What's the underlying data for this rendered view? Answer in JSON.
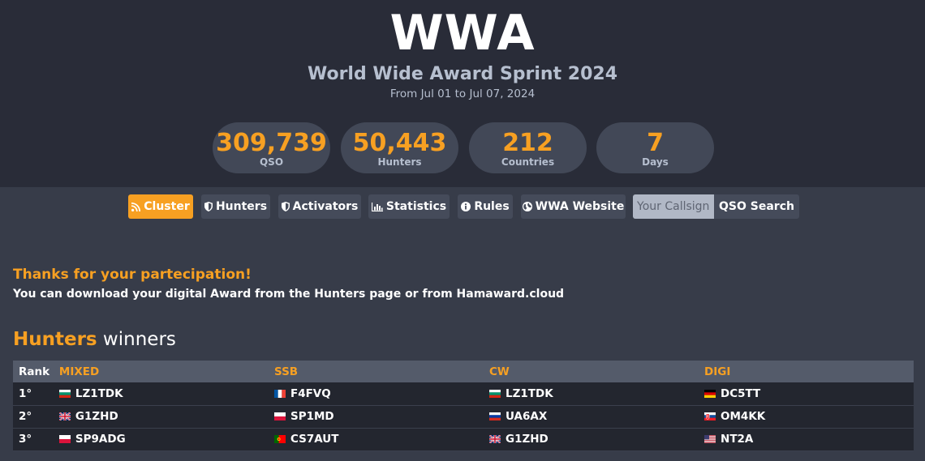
{
  "header": {
    "logo": "WWA",
    "title": "World Wide Award Sprint 2024",
    "dates": "From Jul 01 to Jul 07, 2024"
  },
  "stats": [
    {
      "value": "309,739",
      "label": "QSO"
    },
    {
      "value": "50,443",
      "label": "Hunters"
    },
    {
      "value": "212",
      "label": "Countries"
    },
    {
      "value": "7",
      "label": "Days"
    }
  ],
  "nav": {
    "cluster": {
      "label": "Cluster",
      "icon": "rss-icon"
    },
    "hunters": {
      "label": "Hunters",
      "icon": "shield-icon"
    },
    "activators": {
      "label": "Activators",
      "icon": "shield-icon"
    },
    "statistics": {
      "label": "Statistics",
      "icon": "bar-chart-icon"
    },
    "rules": {
      "label": "Rules",
      "icon": "info-icon"
    },
    "website": {
      "label": "WWA Website",
      "icon": "globe-icon"
    },
    "search_placeholder": "Your Callsign",
    "search_button": "QSO Search"
  },
  "notice": {
    "title": "Thanks for your partecipation!",
    "text": "You can download your digital Award from the Hunters page or from Hamaward.cloud"
  },
  "winners": {
    "title_highlight": "Hunters",
    "title_rest": " winners",
    "columns": [
      "Rank",
      "MIXED",
      "SSB",
      "CW",
      "DIGI"
    ],
    "rows": [
      {
        "rank": "1°",
        "mixed": {
          "call": "LZ1TDK",
          "flag": "bg"
        },
        "ssb": {
          "call": "F4FVQ",
          "flag": "fr"
        },
        "cw": {
          "call": "LZ1TDK",
          "flag": "bg"
        },
        "digi": {
          "call": "DC5TT",
          "flag": "de"
        }
      },
      {
        "rank": "2°",
        "mixed": {
          "call": "G1ZHD",
          "flag": "gb"
        },
        "ssb": {
          "call": "SP1MD",
          "flag": "pl"
        },
        "cw": {
          "call": "UA6AX",
          "flag": "ru"
        },
        "digi": {
          "call": "OM4KK",
          "flag": "sk"
        }
      },
      {
        "rank": "3°",
        "mixed": {
          "call": "SP9ADG",
          "flag": "pl"
        },
        "ssb": {
          "call": "CS7AUT",
          "flag": "pt"
        },
        "cw": {
          "call": "G1ZHD",
          "flag": "gb"
        },
        "digi": {
          "call": "NT2A",
          "flag": "us"
        }
      }
    ]
  },
  "colors": {
    "accent": "#f7a022",
    "header_bg": "#292c38",
    "body_bg": "#373c49"
  }
}
